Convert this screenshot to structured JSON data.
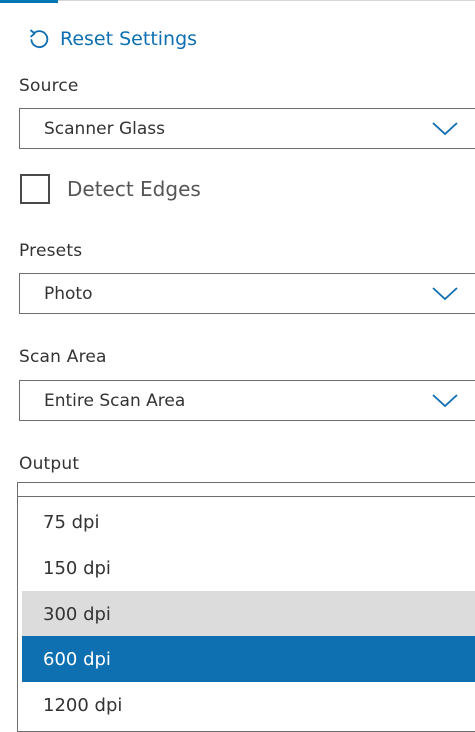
{
  "reset": {
    "label": "Reset Settings",
    "icon": "reset-arrow-icon"
  },
  "source": {
    "label": "Source",
    "value": "Scanner Glass"
  },
  "detect_edges": {
    "label": "Detect Edges",
    "checked": false
  },
  "presets": {
    "label": "Presets",
    "value": "Photo"
  },
  "scan_area": {
    "label": "Scan Area",
    "value": "Entire Scan Area"
  },
  "output": {
    "label": "Output",
    "options": [
      {
        "label": "75 dpi",
        "state": "normal"
      },
      {
        "label": "150 dpi",
        "state": "normal"
      },
      {
        "label": "300 dpi",
        "state": "hovered"
      },
      {
        "label": "600 dpi",
        "state": "selected"
      },
      {
        "label": "1200 dpi",
        "state": "normal"
      }
    ]
  },
  "colors": {
    "accent": "#0e6fb1",
    "hover": "#dcdcdc",
    "border": "#6e6e6e"
  }
}
